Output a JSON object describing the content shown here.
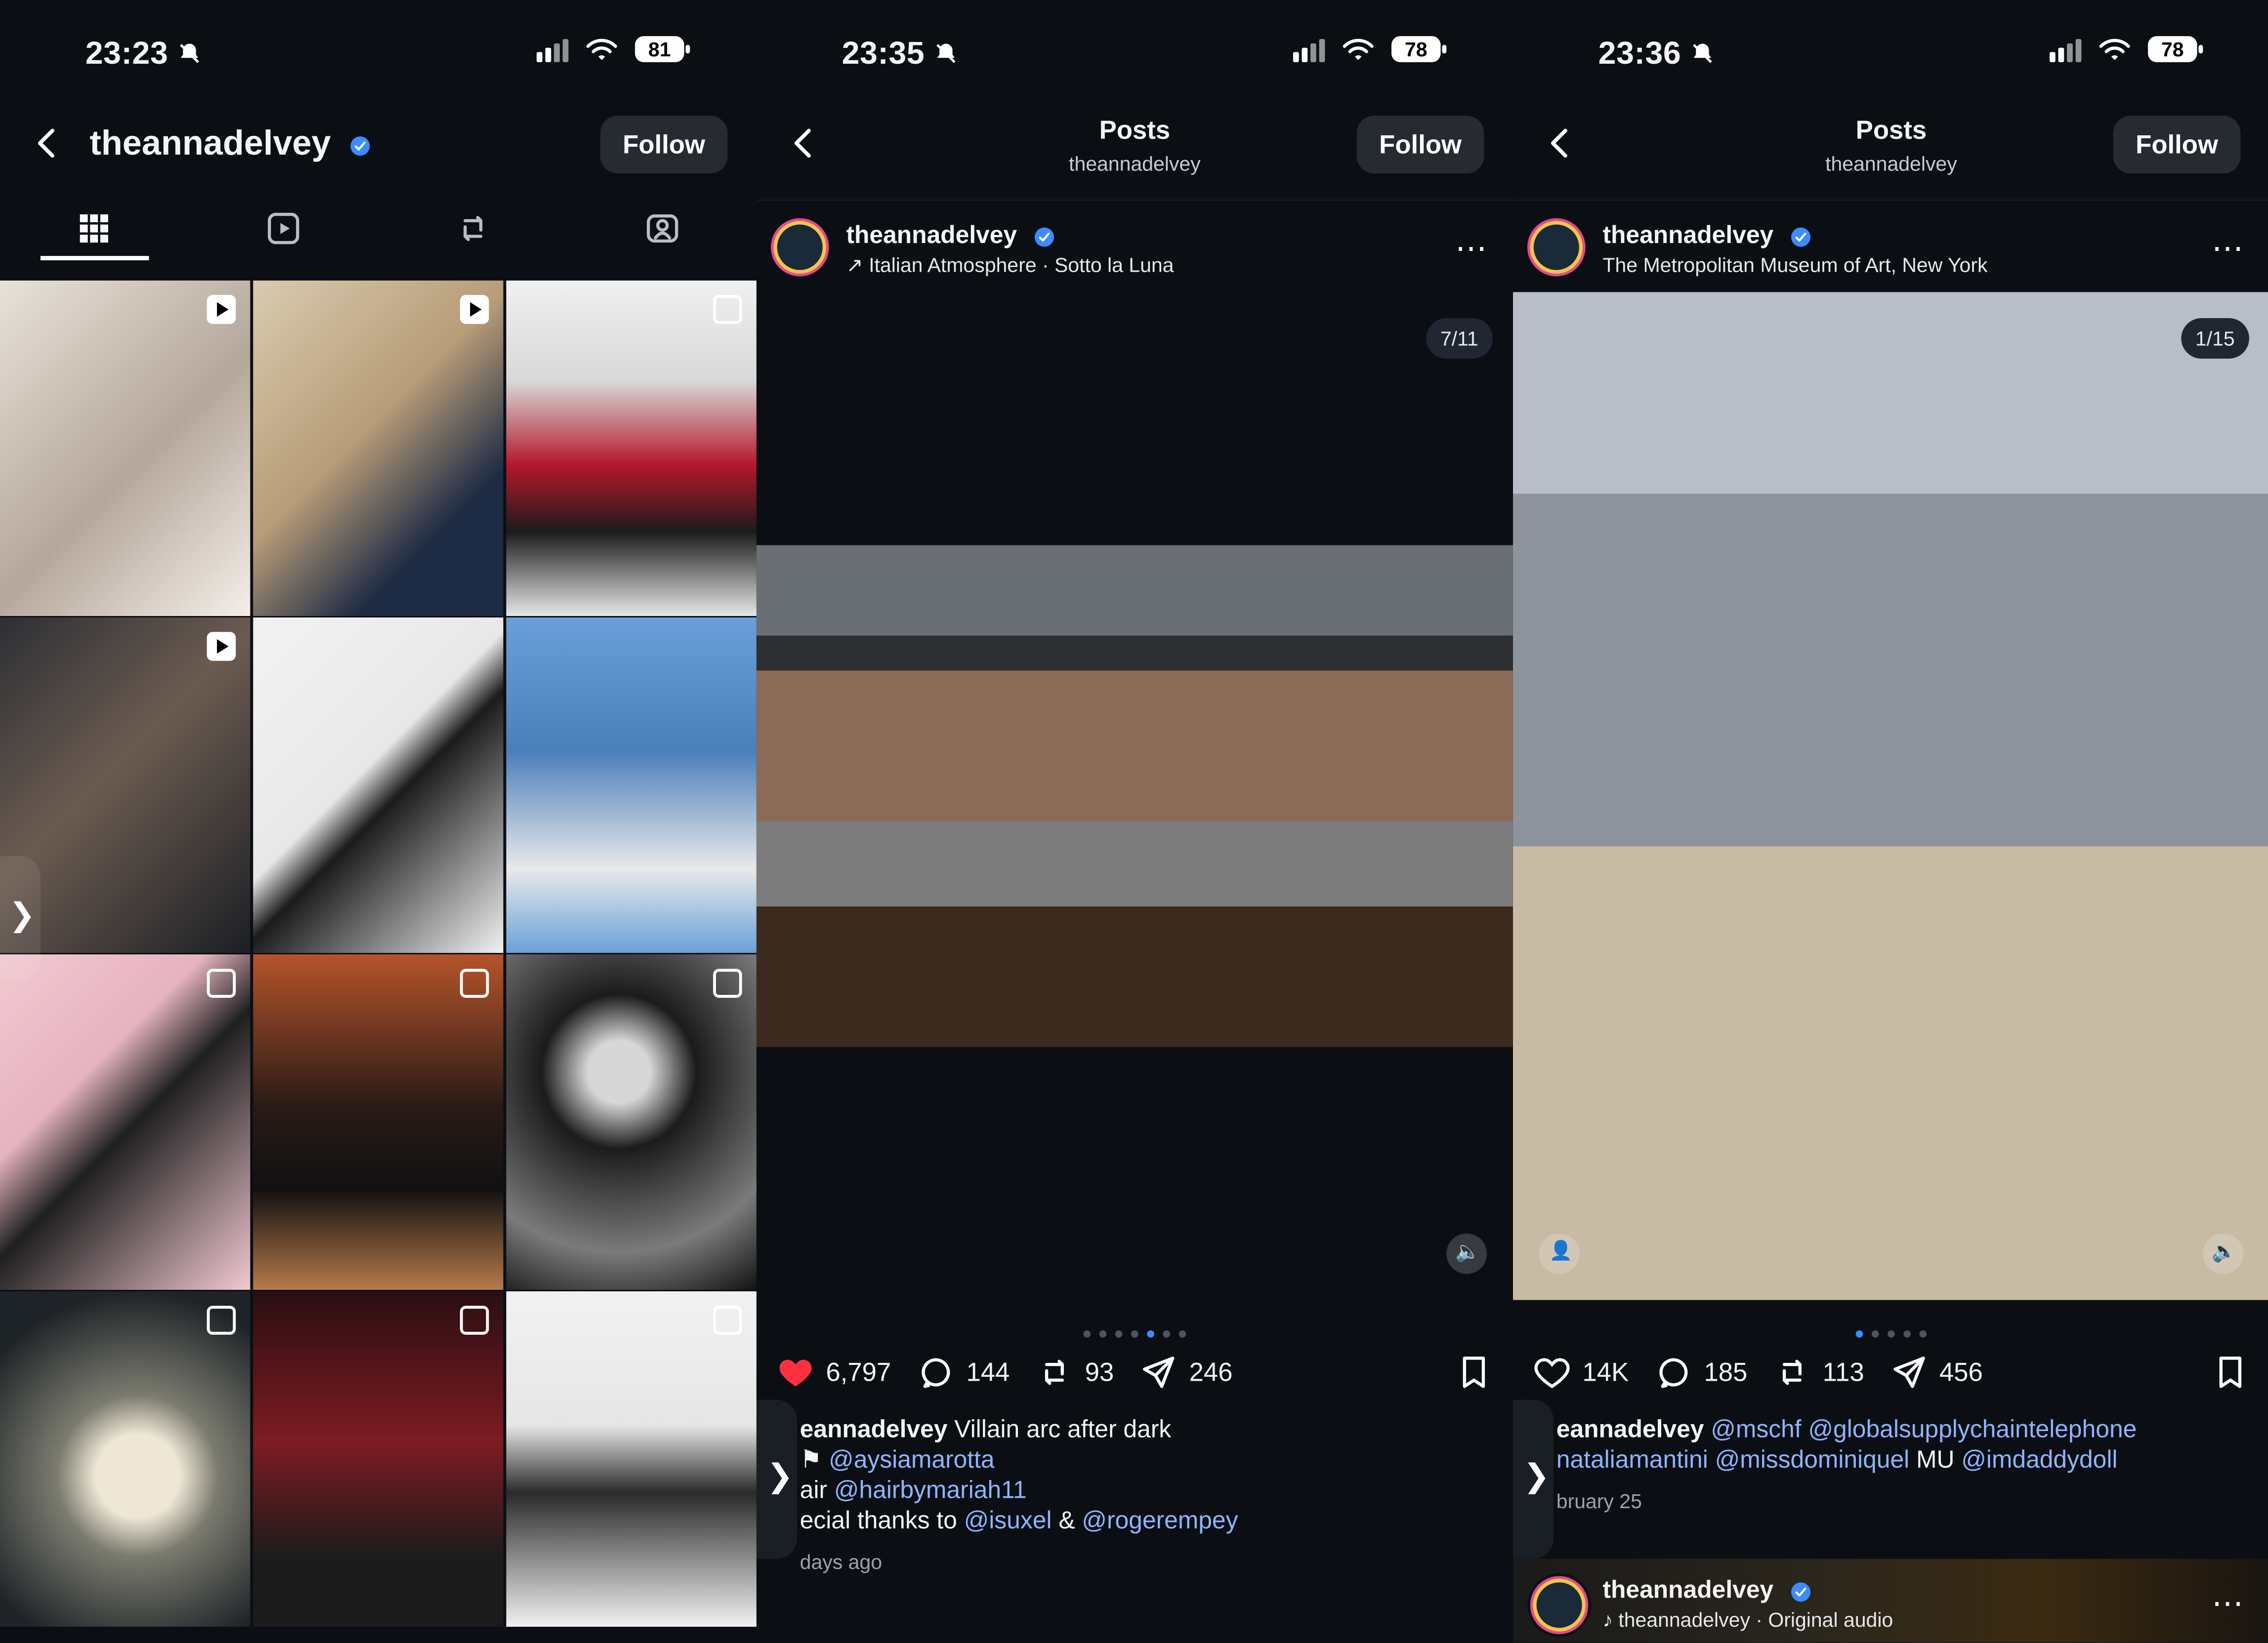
{
  "panels": [
    {
      "time": "23:23",
      "battery": "81",
      "username": "theannadelvey",
      "follow_label": "Follow",
      "tabs": [
        "grid-icon",
        "reels-icon",
        "reposts-icon",
        "tagged-icon"
      ]
    },
    {
      "time": "23:35",
      "battery": "78",
      "header_title": "Posts",
      "header_subtitle": "theannadelvey",
      "follow_label": "Follow",
      "post": {
        "username": "theannadelvey",
        "location_prefix": "↗",
        "location": "Italian Atmosphere · Sotto la Luna",
        "counter": "7/11",
        "likes": "6,797",
        "comments": "144",
        "reposts": "93",
        "shares": "246",
        "caption_user": "eannadelvey",
        "caption_text": "Villain arc after dark",
        "line2_prefix": "⚑",
        "line2_link": "@aysiamarotta",
        "line3_prefix": "air",
        "line3_link": "@hairbymariah11",
        "line4_prefix": "ecial thanks to",
        "line4_link1": "@isuxel",
        "line4_amp": "&",
        "line4_link2": "@rogerempey",
        "posted_ago": "days ago"
      }
    },
    {
      "time": "23:36",
      "battery": "78",
      "header_title": "Posts",
      "header_subtitle": "theannadelvey",
      "follow_label": "Follow",
      "post": {
        "username": "theannadelvey",
        "location": "The Metropolitan Museum of Art, New York",
        "counter": "1/15",
        "likes": "14K",
        "comments": "185",
        "reposts": "113",
        "shares": "456",
        "caption_user": "eannadelvey",
        "caption_link1": "@mschf",
        "caption_link2": "@globalsupplychaintelephone",
        "line2_link1": "nataliamantini",
        "line2_link2": "@missdominiquel",
        "line2_mid": "MU",
        "line2_link3": "@imdaddydoll",
        "date": "bruary 25"
      },
      "next_post": {
        "username": "theannadelvey",
        "audio": "theannadelvey · Original audio"
      }
    }
  ],
  "colors": {
    "accent": "#3d8bff",
    "link": "#8fb4ff",
    "heart": "#ff3040"
  }
}
